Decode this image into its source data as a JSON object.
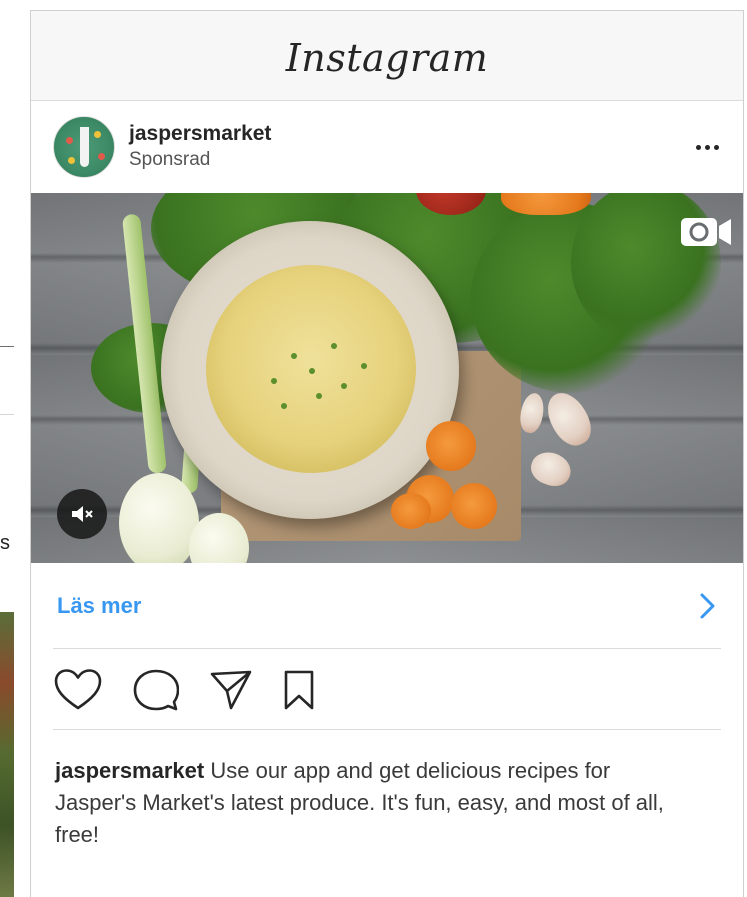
{
  "background_page": {
    "partial_text": "s"
  },
  "app": {
    "title": "Instagram"
  },
  "post": {
    "username": "jaspersmarket",
    "sponsored_label": "Sponsrad",
    "cta_label": "Läs mer",
    "caption_user": "jaspersmarket",
    "caption_text": "Use our app and get delicious recipes for Jasper's Market's latest produce. It's fun, easy, and most of all, free!"
  },
  "icons": {
    "more": "more-options-icon",
    "video": "video-camera-icon",
    "mute": "speaker-muted-icon",
    "chevron": "chevron-right-icon",
    "like": "heart-icon",
    "comment": "comment-icon",
    "share": "paper-plane-icon",
    "save": "bookmark-icon"
  },
  "colors": {
    "link_blue": "#3897f0",
    "text_dark": "#262626",
    "divider": "#dbdbdb",
    "topbar_bg": "#f7f7f7"
  }
}
